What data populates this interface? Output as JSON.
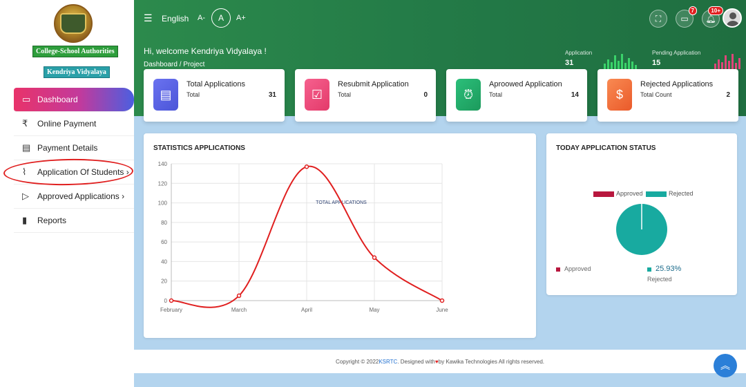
{
  "sidebar": {
    "org_badge": "College-School Authorities",
    "school_badge": "Kendriya Vidyalaya",
    "items": [
      {
        "label": "Dashboard",
        "icon": "monitor-icon",
        "glyph": "▭"
      },
      {
        "label": "Online Payment",
        "icon": "rupee-icon",
        "glyph": "₹"
      },
      {
        "label": "Payment Details",
        "icon": "document-list-icon",
        "glyph": "▤"
      },
      {
        "label": "Application Of Students ›",
        "icon": "pulse-icon",
        "glyph": "⌇"
      },
      {
        "label": "Approved Applications ›",
        "icon": "double-chevron-icon",
        "glyph": "▷"
      },
      {
        "label": "Reports",
        "icon": "file-icon",
        "glyph": "▮"
      }
    ]
  },
  "topbar": {
    "language": "English",
    "font_minus": "A-",
    "font_normal": "A",
    "font_plus": "A+",
    "cart_badge": "7",
    "notif_badge": "10+"
  },
  "header": {
    "welcome": "Hi, welcome Kendriya Vidyalaya !",
    "breadcrumb": "Dashboard  /  Project",
    "stat1_label": "Application",
    "stat1_value": "31",
    "stat2_label": "Pending Application",
    "stat2_value": "15"
  },
  "cards": [
    {
      "title": "Total Applications",
      "sub": "Total",
      "value": "31",
      "icon": "document-icon",
      "color": "#5b63e8"
    },
    {
      "title": "Resubmit Application",
      "sub": "Total",
      "value": "0",
      "icon": "clipboard-icon",
      "color": "#f0447a"
    },
    {
      "title": "Aproowed Application",
      "sub": "Total",
      "value": "14",
      "icon": "alarm-clock-icon",
      "color": "#22a86a"
    },
    {
      "title": "Rejected Applications",
      "sub": "Total Count",
      "value": "2",
      "icon": "money-bag-icon",
      "color": "#f26b3a"
    }
  ],
  "stats_panel": {
    "title": "STATISTICS APPLICATIONS"
  },
  "status_panel": {
    "title": "TODAY APPLICATION STATUS",
    "legend_approved": "Approved",
    "legend_rejected": "Rejected",
    "bottom_approved": "Approved",
    "bottom_percent": "25.93%",
    "bottom_rejected": "Rejected"
  },
  "footer": {
    "prefix": "Copyright © 2022 ",
    "brand": "KSRTC",
    "mid": ". Designed with ",
    "suffix": " by Kawika Technologies All rights reserved."
  },
  "chart_data": [
    {
      "type": "line",
      "title": "TOTAL APPLICATIONS",
      "categories": [
        "February",
        "March",
        "April",
        "May",
        "June"
      ],
      "series": [
        {
          "values": [
            0,
            5,
            137,
            44,
            0
          ],
          "color": "#e01f1f"
        }
      ],
      "ylim": [
        0,
        140
      ],
      "yticks": [
        0,
        20,
        40,
        60,
        80,
        100,
        120,
        140
      ],
      "grid": true
    },
    {
      "type": "pie",
      "categories": [
        "Approved",
        "Rejected"
      ],
      "values": [
        0,
        100
      ],
      "colors": [
        "#b8173e",
        "#18aaa0"
      ]
    }
  ]
}
